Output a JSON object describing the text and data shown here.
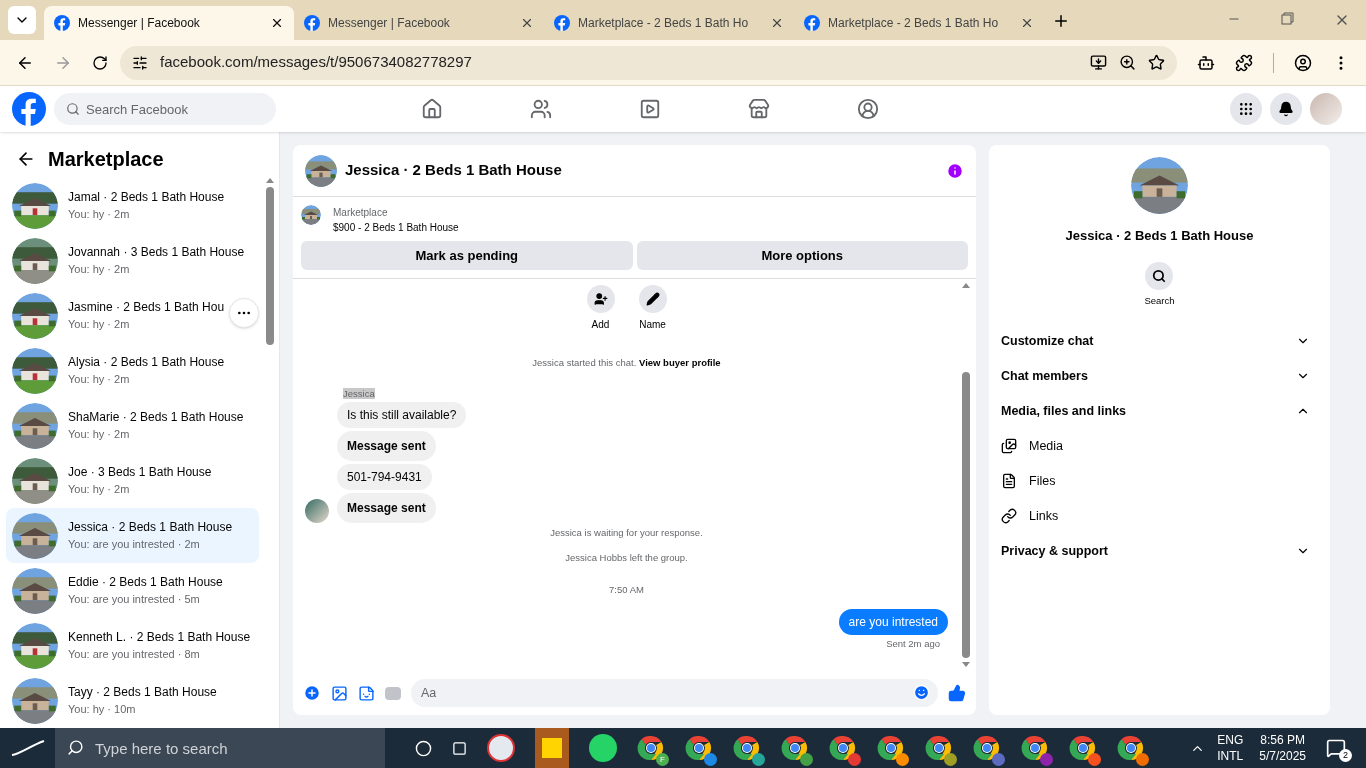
{
  "browser": {
    "tabs": [
      {
        "title": "Messenger | Facebook",
        "selected": true
      },
      {
        "title": "Messenger | Facebook",
        "selected": false
      },
      {
        "title": "Marketplace - 2 Beds 1 Bath Ho",
        "selected": false
      },
      {
        "title": "Marketplace - 2 Beds 1 Bath Ho",
        "selected": false
      }
    ],
    "url": "facebook.com/messages/t/9506734082778297"
  },
  "facebook": {
    "search_placeholder": "Search Facebook"
  },
  "sidebar": {
    "title": "Marketplace",
    "conversations": [
      {
        "name": "Jamal · 2 Beds 1 Bath House",
        "snippet": "You: hy · 2m",
        "selected": false
      },
      {
        "name": "Jovannah · 3 Beds 1 Bath House",
        "snippet": "You: hy · 2m",
        "selected": false
      },
      {
        "name": "Jasmine · 2 Beds 1 Bath Hou",
        "snippet": "You: hy · 2m",
        "selected": false,
        "hovered": true
      },
      {
        "name": "Alysia · 2 Beds 1 Bath House",
        "snippet": "You: hy · 2m",
        "selected": false
      },
      {
        "name": "ShaMarie · 2 Beds 1 Bath House",
        "snippet": "You: hy · 2m",
        "selected": false
      },
      {
        "name": "Joe · 3 Beds 1 Bath House",
        "snippet": "You: hy · 2m",
        "selected": false
      },
      {
        "name": "Jessica · 2 Beds 1 Bath House",
        "snippet": "You: are you intrested · 2m",
        "selected": true
      },
      {
        "name": "Eddie · 2 Beds 1 Bath House",
        "snippet": "You: are you intrested · 5m",
        "selected": false
      },
      {
        "name": "Kenneth L. · 2 Beds 1 Bath House",
        "snippet": "You: are you intrested · 8m",
        "selected": false
      },
      {
        "name": "Tayy · 2 Beds 1 Bath House",
        "snippet": "You: hy · 10m",
        "selected": false
      }
    ]
  },
  "chat": {
    "title": "Jessica · 2 Beds 1 Bath House",
    "listing": {
      "label": "Marketplace",
      "description": "$900 - 2 Beds 1 Bath House"
    },
    "buttons": [
      "Mark as pending",
      "More options"
    ],
    "actions": [
      "Add",
      "Name"
    ],
    "messages": [
      {
        "kind": "system",
        "text": "Jessica started this chat.",
        "link": "View buyer profile"
      },
      {
        "kind": "sender",
        "text": "Jessica"
      },
      {
        "kind": "incoming",
        "text": "Is this still available?",
        "bold": false,
        "avatar": false
      },
      {
        "kind": "incoming",
        "text": "Message sent",
        "bold": true,
        "avatar": false
      },
      {
        "kind": "incoming",
        "text": "501-794-9431",
        "bold": false,
        "avatar": false
      },
      {
        "kind": "incoming",
        "text": "Message sent",
        "bold": true,
        "avatar": true
      },
      {
        "kind": "system",
        "text": "Jessica is waiting for your response."
      },
      {
        "kind": "system",
        "text": "Jessica Hobbs left the group."
      },
      {
        "kind": "time",
        "text": "7:50 AM"
      },
      {
        "kind": "outgoing",
        "text": "are you intrested"
      },
      {
        "kind": "status",
        "text": "Sent 2m ago"
      }
    ],
    "composer_placeholder": "Aa"
  },
  "details": {
    "title": "Jessica · 2 Beds 1 Bath House",
    "search_label": "Search",
    "sections": [
      {
        "label": "Customize chat",
        "expanded": false
      },
      {
        "label": "Chat members",
        "expanded": false
      },
      {
        "label": "Media, files and links",
        "expanded": true,
        "children": [
          {
            "label": "Media"
          },
          {
            "label": "Files"
          },
          {
            "label": "Links"
          }
        ]
      },
      {
        "label": "Privacy & support",
        "expanded": false
      }
    ]
  },
  "taskbar": {
    "search_placeholder": "Type here to search",
    "chrome_profiles": [
      {
        "badge": "F",
        "color": "#4caf50"
      },
      {
        "color": "#1e88e5"
      },
      {
        "color": "#26a69a"
      },
      {
        "color": "#43a047"
      },
      {
        "color": "#e53935"
      },
      {
        "color": "#fb8c00"
      },
      {
        "color": "#9e9d24"
      },
      {
        "color": "#5c6bc0"
      },
      {
        "color": "#8e24aa"
      },
      {
        "color": "#f4511e"
      },
      {
        "color": "#ef6c00"
      }
    ],
    "language": "ENG",
    "layout": "INTL",
    "time": "8:56 PM",
    "date": "5/7/2025",
    "notifications": "2"
  }
}
